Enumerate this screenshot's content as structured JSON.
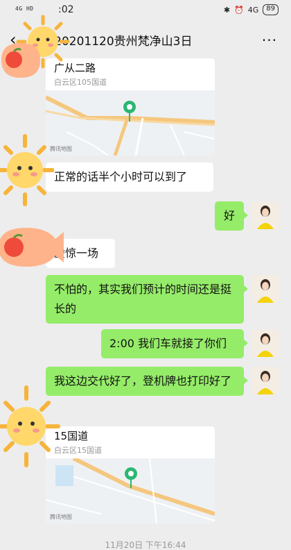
{
  "status_bar": {
    "left_signal": "4G HD",
    "time": ":02",
    "network": "4G",
    "battery": "89"
  },
  "nav": {
    "title": "L    R-20201120贵州梵净山3日",
    "more": "···"
  },
  "messages": {
    "loc1_title": "广从二路",
    "loc1_sub": "白云区105国道",
    "loc1_credit": "腾讯地图",
    "msg1": "正常的话半个小时可以到了",
    "msg2": "好",
    "msg3": "虚惊一场",
    "msg4": "不怕的，其实我们预计的时间还是挺长的",
    "msg5": "2:00 我们车就接了你们",
    "msg6": "我这边交代好了，登机牌也打印好了",
    "loc2_title": "15国道",
    "loc2_sub": "白云区15国道",
    "loc2_credit": "腾讯地图",
    "timestamp": "11月20日 下午16:44"
  },
  "colors": {
    "background": "#ededed",
    "bubble_right": "#95ec69",
    "bubble_left": "#ffffff",
    "pin": "#2bb673"
  }
}
